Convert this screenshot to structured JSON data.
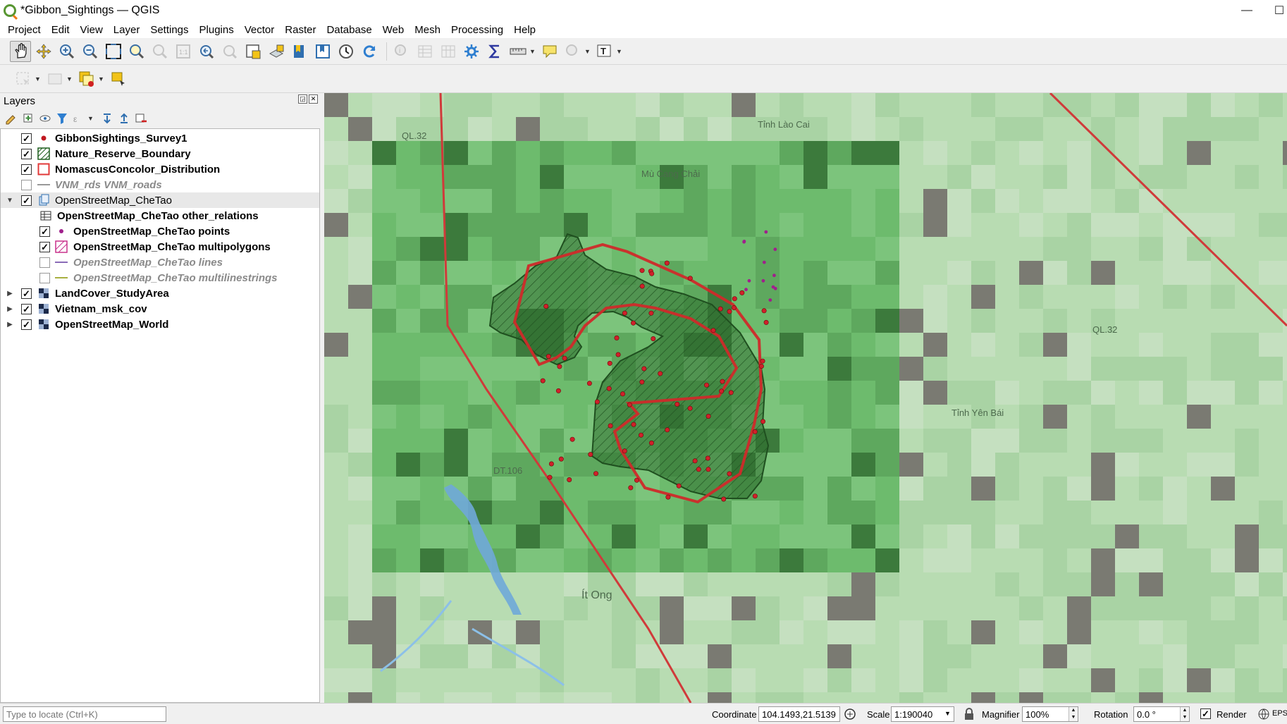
{
  "window": {
    "title": "*Gibbon_Sightings — QGIS",
    "minimize": "—",
    "maximize": "☐"
  },
  "menu": [
    "Project",
    "Edit",
    "View",
    "Layer",
    "Settings",
    "Plugins",
    "Vector",
    "Raster",
    "Database",
    "Web",
    "Mesh",
    "Processing",
    "Help"
  ],
  "layers_panel": {
    "title": "Layers",
    "layers": [
      {
        "name": "GibbonSightings_Survey1",
        "checked": "✓",
        "symbol": "point-red"
      },
      {
        "name": "Nature_Reserve_Boundary",
        "checked": "✓",
        "symbol": "polygon-hatch-green"
      },
      {
        "name": "NomascusConcolor_Distribution",
        "checked": "✓",
        "symbol": "polygon-outline-red"
      },
      {
        "name": "VNM_rds VNM_roads",
        "checked": "",
        "symbol": "line-grey"
      },
      {
        "name": "OpenStreetMap_CheTao",
        "checked": "✓",
        "symbol": "group-db"
      },
      {
        "name": "OpenStreetMap_CheTao other_relations",
        "checked": "",
        "symbol": "table"
      },
      {
        "name": "OpenStreetMap_CheTao points",
        "checked": "✓",
        "symbol": "point-purple"
      },
      {
        "name": "OpenStreetMap_CheTao multipolygons",
        "checked": "✓",
        "symbol": "polygon-hatch-pink"
      },
      {
        "name": "OpenStreetMap_CheTao lines",
        "checked": "",
        "symbol": "line-purple"
      },
      {
        "name": "OpenStreetMap_CheTao multilinestrings",
        "checked": "",
        "symbol": "line-olive"
      },
      {
        "name": "LandCover_StudyArea",
        "checked": "✓",
        "symbol": "raster"
      },
      {
        "name": "Vietnam_msk_cov",
        "checked": "✓",
        "symbol": "raster"
      },
      {
        "name": "OpenStreetMap_World",
        "checked": "✓",
        "symbol": "raster"
      }
    ]
  },
  "map": {
    "place_labels": [
      "Tỉnh Lào Cai",
      "Mù Cang Chải",
      "QL.32",
      "DT.106",
      "Tỉnh Yên Bái",
      "Ít Ong",
      "QL.32"
    ],
    "colors": {
      "sightings": "#d0202a",
      "distribution": "#cf2a2a",
      "reserve": "#1f5f1f",
      "osm_points": "#a0208c"
    }
  },
  "status": {
    "locator_placeholder": "Type to locate (Ctrl+K)",
    "coordinate_label": "Coordinate",
    "coordinate_value": "104.1493,21.5139",
    "scale_label": "Scale",
    "scale_value": "1:190040",
    "magnifier_label": "Magnifier",
    "magnifier_value": "100%",
    "rotation_label": "Rotation",
    "rotation_value": "0.0 °",
    "render_label": "Render",
    "crs_label": "EPS"
  }
}
